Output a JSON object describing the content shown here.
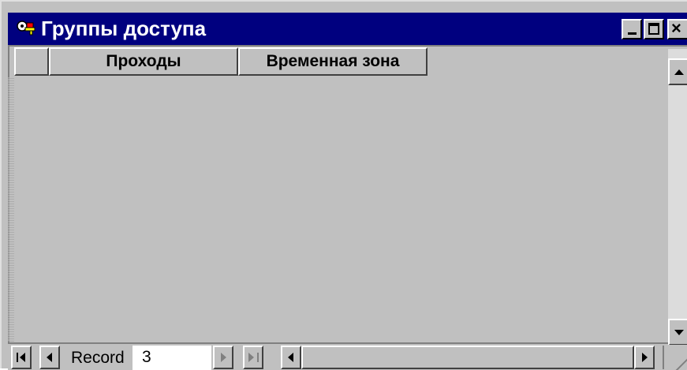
{
  "window": {
    "title": "Группы доступа",
    "icon": "app-keys-icon",
    "titlebar_color": "#00007f"
  },
  "grid": {
    "columns": [
      "Проходы",
      "Временная зона"
    ],
    "rows": []
  },
  "navigation": {
    "record_label": "Record",
    "record_number": "3",
    "buttons": [
      "first-record-icon",
      "prev-record-icon",
      "next-record-icon",
      "last-record-icon"
    ]
  },
  "colors": {
    "face": "#c0c0c0",
    "shadow": "#808080",
    "highlight": "#ffffff"
  }
}
